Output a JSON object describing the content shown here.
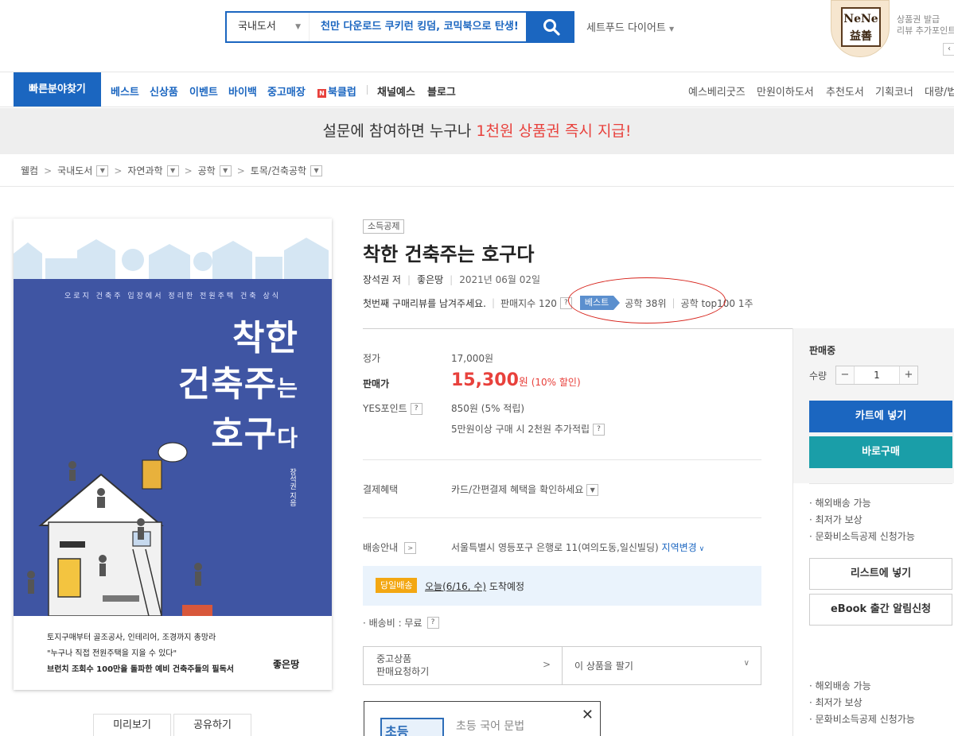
{
  "header": {
    "search_category": "국내도서",
    "search_promo": "천만 다운로드 쿠키런 킹덤, 코믹북으로 탄생!",
    "setfood_link": "세트푸드 다이어트",
    "nene_line1": "NeNe",
    "nene_line2": "益善",
    "side_promo_line1": "상품권 발급",
    "side_promo_line2": "리뷰 추가포인트",
    "side_prev": "‹"
  },
  "gnb": {
    "quick_button": "빠른분야찾기",
    "items": [
      "베스트",
      "신상품",
      "이벤트",
      "바이백",
      "중고매장",
      "북클럽",
      "채널예스",
      "블로그"
    ],
    "bookclub_icon_letter": "N",
    "right_items": [
      "예스베리굿즈",
      "만원이하도서",
      "추천도서",
      "기획코너",
      "대량/법인"
    ]
  },
  "banner": {
    "text_before": "설문에 참여하면 누구나 ",
    "text_highlight": "1천원 상품권 즉시 지급!"
  },
  "breadcrumb": [
    "웰컴",
    "국내도서",
    "자연과학",
    "공학",
    "토목/건축공학"
  ],
  "cover": {
    "subtitle": "오로지 건축주 입장에서 정리한 전원주택 건축 상식",
    "title_line1": "착한",
    "title_line2_main": "건축주",
    "title_line2_small": "는",
    "title_line3_main": "호구",
    "title_line3_small": "다",
    "author_vertical": "장석권 지음",
    "copy_line1": "토지구매부터 골조공사, 인테리어, 조경까지 총망라",
    "copy_line2": "\"누구나 직접 전원주택을 지을 수 있다\"",
    "copy_line3": "브런치 조회수 100만을 돌파한 예비 건축주들의 필독서",
    "publisher_logo": "좋은땅"
  },
  "cover_buttons": {
    "preview": "미리보기",
    "share": "공유하기"
  },
  "product": {
    "tag": "소득공제",
    "title": "착한 건축주는 호구다",
    "author": "장석권 저",
    "publisher": "좋은땅",
    "date": "2021년 06월 02일",
    "review_prompt": "첫번째 구매리뷰를 남겨주세요.",
    "sales_index": "판매지수 120",
    "best_tag": "베스트",
    "rank1": "공학 38위",
    "rank2": "공학 top100 1주"
  },
  "price": {
    "list_label": "정가",
    "list_value": "17,000원",
    "sale_label": "판매가",
    "sale_value": "15,300",
    "sale_unit": "원",
    "sale_discount": "(10% 할인)",
    "point_label": "YES포인트",
    "point_value": "850원 (5% 적립)",
    "extra_point": "5만원이상 구매 시 2천원 추가적립",
    "payment_label": "결제혜택",
    "payment_value": "카드/간편결제 혜택을 확인하세요",
    "delivery_label": "배송안내",
    "delivery_address": "서울특별시 영등포구 은행로 11(여의도동,일신빌딩)",
    "region_change": "지역변경",
    "today_badge": "당일배송",
    "today_date": "오늘(6/16, 수)",
    "today_suffix": " 도착예정",
    "ship_fee": "· 배송비 : 무료",
    "used_line1": "중고상품",
    "used_line2": "판매요청하기",
    "sell_label": "이 상품을 팔기"
  },
  "ad": {
    "logo_text": "초등",
    "text": "초등 국어 문법"
  },
  "side": {
    "status": "판매중",
    "qty_label": "수량",
    "qty_value": "1",
    "minus": "−",
    "plus": "+",
    "cart_button": "카트에 넣기",
    "buy_button": "바로구매",
    "benefits": [
      "· 해외배송 가능",
      "· 최저가 보상",
      "· 문화비소득공제 신청가능"
    ],
    "wish_button": "리스트에 넣기",
    "ebook_button": "eBook 출간 알림신청",
    "benefits2": [
      "· 해외배송 가능",
      "· 최저가 보상",
      "· 문화비소득공제 신청가능"
    ]
  },
  "colors": {
    "brand_blue": "#1b66c0",
    "accent_red": "#e8413c",
    "teal": "#1a9ea8",
    "cover_blue": "#3f55a3",
    "today_badge": "#f3a712"
  }
}
